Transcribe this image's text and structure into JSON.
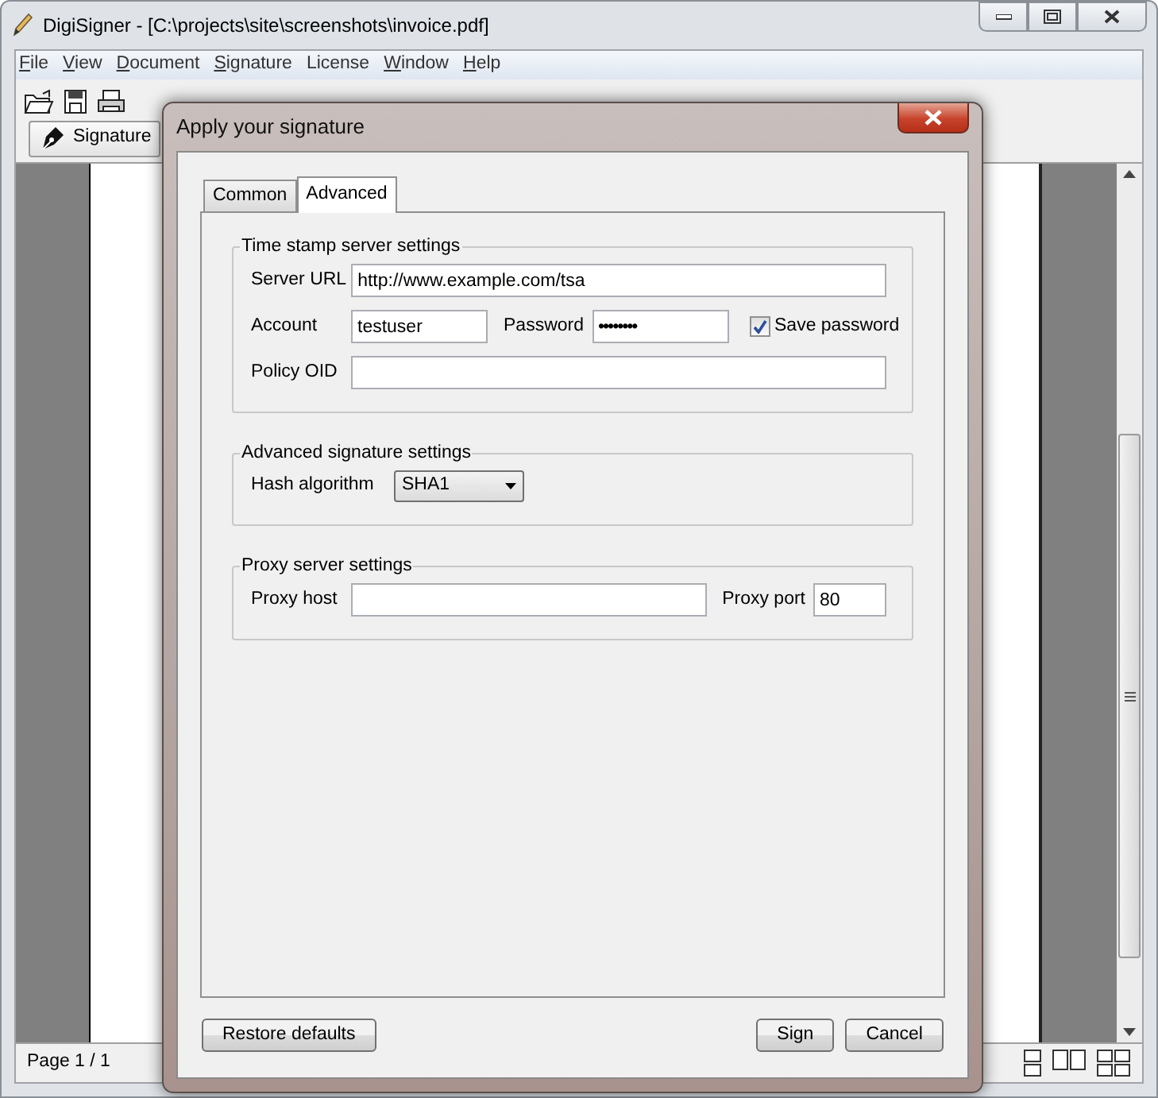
{
  "window": {
    "title": "DigiSigner - [C:\\projects\\site\\screenshots\\invoice.pdf]"
  },
  "menu": [
    {
      "label": "File",
      "mnemonic": true
    },
    {
      "label": "View",
      "mnemonic": true
    },
    {
      "label": "Document",
      "mnemonic": true
    },
    {
      "label": "Signature",
      "mnemonic": true
    },
    {
      "label": "License",
      "mnemonic": false
    },
    {
      "label": "Window",
      "mnemonic": true
    },
    {
      "label": "Help",
      "mnemonic": true
    }
  ],
  "signature_button": "Signature",
  "status_bar": {
    "page": "Page 1 / 1"
  },
  "dialog": {
    "title": "Apply your signature",
    "tabs": [
      {
        "label": "Common",
        "selected": false
      },
      {
        "label": "Advanced",
        "selected": true
      }
    ],
    "groups": [
      {
        "title": "Time stamp server settings",
        "rows": [
          [
            {
              "kind": "label",
              "text": "Server URL"
            },
            {
              "kind": "input",
              "value": "http://www.example.com/tsa"
            }
          ],
          [
            {
              "kind": "label",
              "text": "Account"
            },
            {
              "kind": "input",
              "value": "testuser"
            },
            {
              "kind": "label",
              "text": "Password"
            },
            {
              "kind": "password",
              "value": "••••••••"
            },
            {
              "kind": "checkbox",
              "text": "Save password",
              "checked": true
            }
          ],
          [
            {
              "kind": "label",
              "text": "Policy OID"
            },
            {
              "kind": "input"
            }
          ]
        ]
      },
      {
        "title": "Advanced signature settings",
        "rows": [
          [
            {
              "kind": "label",
              "text": "Hash algorithm"
            },
            {
              "kind": "select",
              "value": "SHA1"
            }
          ]
        ]
      },
      {
        "title": "Proxy server settings",
        "rows": [
          [
            {
              "kind": "label",
              "text": "Proxy host"
            },
            {
              "kind": "input"
            },
            {
              "kind": "label",
              "text": "Proxy port"
            },
            {
              "kind": "input",
              "value": "80"
            }
          ]
        ]
      }
    ],
    "left_buttons": [
      "Restore defaults"
    ],
    "right_buttons": [
      "Sign",
      "Cancel"
    ]
  }
}
